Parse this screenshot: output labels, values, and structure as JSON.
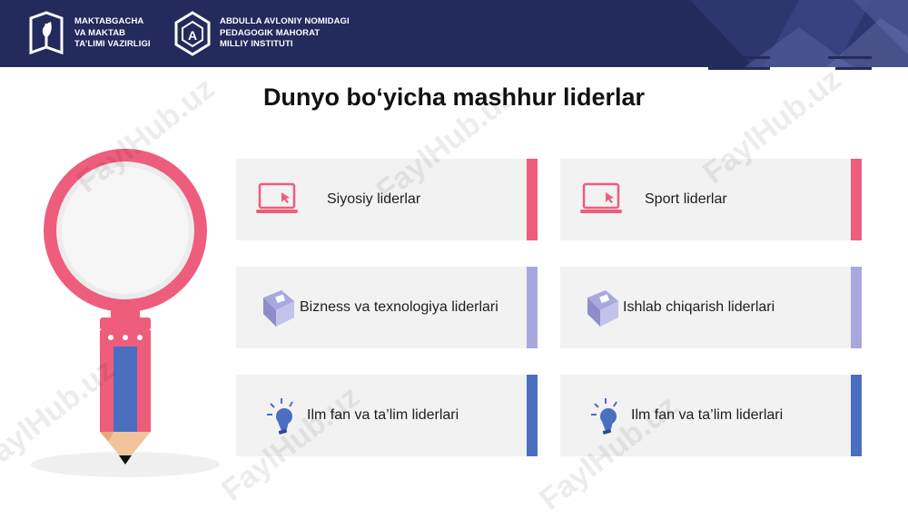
{
  "header": {
    "logo1": {
      "lines": [
        "MAKTABGACHA",
        "VA MAKTAB",
        "TA’LIMI VAZIRLIGI"
      ]
    },
    "logo2": {
      "lines": [
        "ABDULLA AVLONIY NOMIDAGI",
        "PEDAGOGIK MAHORAT",
        "MILLIY INSTITUTI"
      ]
    }
  },
  "title": "Dunyo bo‘yicha mashhur liderlar",
  "cards": [
    {
      "label": "Siyosiy liderlar",
      "icon": "laptop-icon",
      "accent": "#ee5d7c"
    },
    {
      "label": "Sport liderlar",
      "icon": "laptop-icon",
      "accent": "#ee5d7c"
    },
    {
      "label": "Bizness va texnologiya liderlari",
      "icon": "book-icon",
      "accent": "#a9a8de"
    },
    {
      "label": "Ishlab chiqarish liderlari",
      "icon": "book-icon",
      "accent": "#a9a8de"
    },
    {
      "label": "Ilm fan va ta’lim liderlari",
      "icon": "lightbulb-icon",
      "accent": "#4a6fc0"
    },
    {
      "label": "Ilm fan va ta’lim liderlari",
      "icon": "lightbulb-icon",
      "accent": "#4a6fc0"
    }
  ],
  "watermark": "FaylHub.uz",
  "colors": {
    "header_bg": "#232a5c",
    "pink": "#ee5d7c",
    "lavender": "#a9a8de",
    "blue": "#4a6fc0",
    "card_bg": "#f2f2f3"
  }
}
